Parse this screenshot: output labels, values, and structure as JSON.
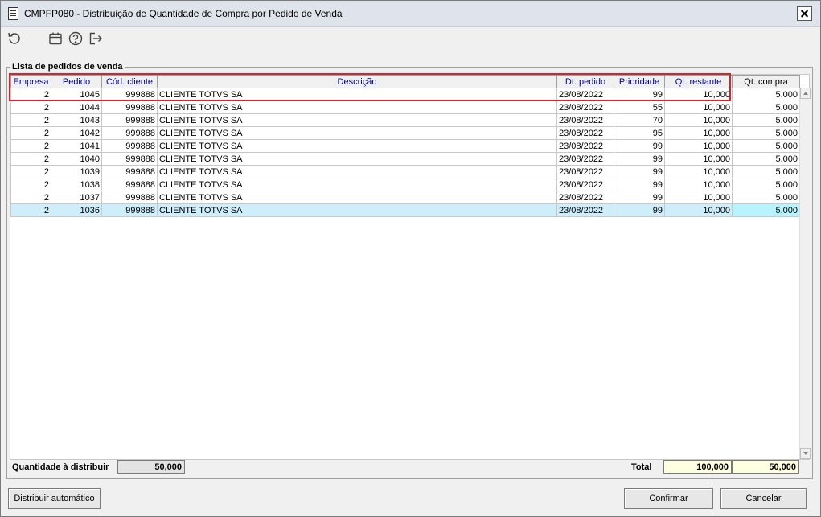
{
  "window": {
    "title": "CMPFP080 - Distribuição de Quantidade de Compra por Pedido de Venda"
  },
  "toolbar": {
    "icons": [
      "refresh-icon",
      "calendar-icon",
      "help-icon",
      "exit-icon"
    ]
  },
  "group": {
    "label": "Lista de pedidos de venda"
  },
  "grid": {
    "columns": [
      "Empresa",
      "Pedido",
      "Cód. cliente",
      "Descrição",
      "Dt. pedido",
      "Prioridade",
      "Qt. restante",
      "Qt. compra"
    ],
    "rows": [
      [
        "2",
        "1045",
        "999888",
        "CLIENTE TOTVS SA",
        "23/08/2022",
        "99",
        "10,000",
        "5,000"
      ],
      [
        "2",
        "1044",
        "999888",
        "CLIENTE TOTVS SA",
        "23/08/2022",
        "55",
        "10,000",
        "5,000"
      ],
      [
        "2",
        "1043",
        "999888",
        "CLIENTE TOTVS SA",
        "23/08/2022",
        "70",
        "10,000",
        "5,000"
      ],
      [
        "2",
        "1042",
        "999888",
        "CLIENTE TOTVS SA",
        "23/08/2022",
        "95",
        "10,000",
        "5,000"
      ],
      [
        "2",
        "1041",
        "999888",
        "CLIENTE TOTVS SA",
        "23/08/2022",
        "99",
        "10,000",
        "5,000"
      ],
      [
        "2",
        "1040",
        "999888",
        "CLIENTE TOTVS SA",
        "23/08/2022",
        "99",
        "10,000",
        "5,000"
      ],
      [
        "2",
        "1039",
        "999888",
        "CLIENTE TOTVS SA",
        "23/08/2022",
        "99",
        "10,000",
        "5,000"
      ],
      [
        "2",
        "1038",
        "999888",
        "CLIENTE TOTVS SA",
        "23/08/2022",
        "99",
        "10,000",
        "5,000"
      ],
      [
        "2",
        "1037",
        "999888",
        "CLIENTE TOTVS SA",
        "23/08/2022",
        "99",
        "10,000",
        "5,000"
      ],
      [
        "2",
        "1036",
        "999888",
        "CLIENTE TOTVS SA",
        "23/08/2022",
        "99",
        "10,000",
        "5,000"
      ]
    ],
    "selected_row_index": 9
  },
  "footer": {
    "qty_label": "Quantidade à distribuir",
    "qty_value": "50,000",
    "total_label": "Total",
    "total_restante": "100,000",
    "total_compra": "50,000"
  },
  "buttons": {
    "auto": "Distribuir automático",
    "confirm": "Confirmar",
    "cancel": "Cancelar"
  },
  "colors": {
    "header_text": "#00008b",
    "selected_row": "#cdeefa",
    "highlight_border": "#d8232a",
    "total_field": "#fefee0"
  }
}
